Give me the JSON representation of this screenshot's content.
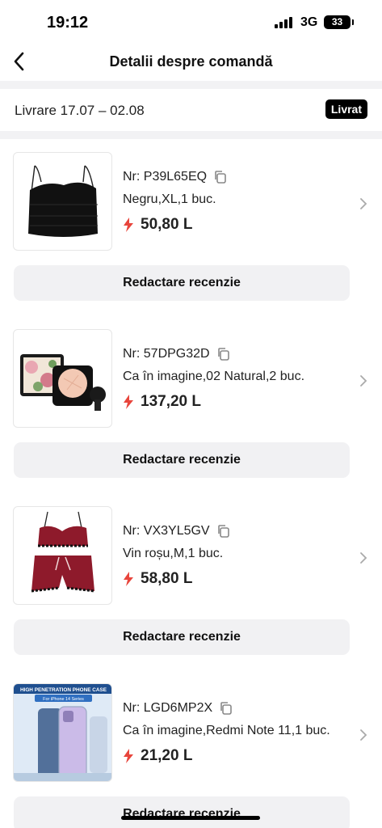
{
  "status_bar": {
    "time": "19:12",
    "network": "3G",
    "battery": "33",
    "signal_bars": 4
  },
  "header": {
    "back_icon": "chevron-left-icon",
    "title": "Detalii despre comandă"
  },
  "delivery": {
    "text": "Livrare 17.07 – 02.08",
    "status": "Livrat"
  },
  "colors": {
    "accent_red": "#e8453c",
    "badge_bg": "#000000",
    "button_bg": "#f1f1f3",
    "divider": "#f2f2f4"
  },
  "items": [
    {
      "image_icon": "black-camisole-top-image",
      "nr": "Nr: P39L65EQ",
      "variant": "Negru,XL,1 buc.",
      "price": "50,80 L",
      "review_label": "Redactare recenzie"
    },
    {
      "image_icon": "cushion-foundation-set-image",
      "nr": "Nr: 57DPG32D",
      "variant": "Ca în imagine,02 Natural,2 buc.",
      "price": "137,20 L",
      "review_label": "Redactare recenzie"
    },
    {
      "image_icon": "red-satin-pajama-set-image",
      "nr": "Nr: VX3YL5GV",
      "variant": "Vin roșu,M,1 buc.",
      "price": "58,80 L",
      "review_label": "Redactare recenzie"
    },
    {
      "image_icon": "phone-case-image",
      "image_caption_1": "HIGH PENETRATION PHONE CASE",
      "image_caption_2": "For iPhone 14 Series",
      "nr": "Nr: LGD6MP2X",
      "variant": "Ca în imagine,Redmi Note 11,1 buc.",
      "price": "21,20 L",
      "review_label": "Redactare recenzie"
    }
  ]
}
